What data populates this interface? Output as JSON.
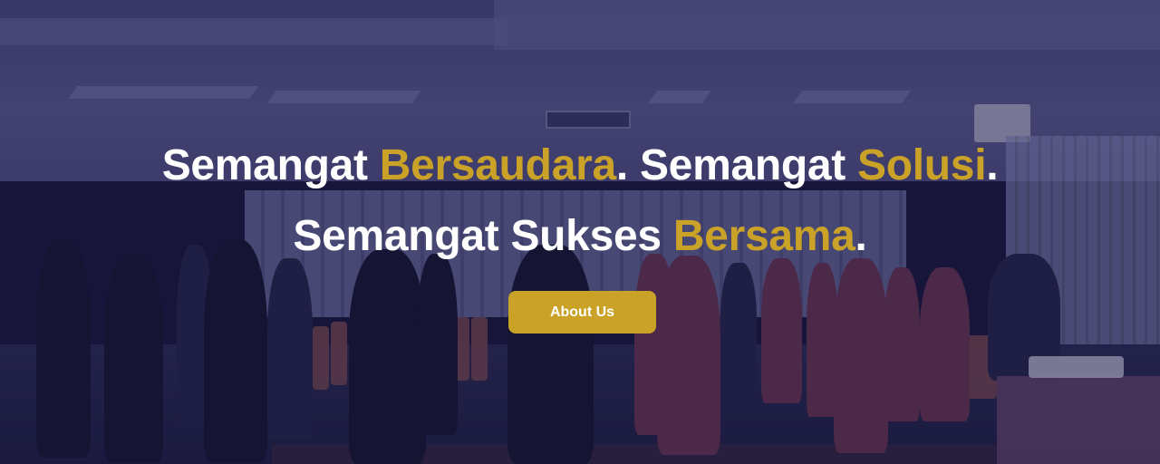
{
  "hero": {
    "line1": {
      "part1": "Semangat ",
      "accent1": "Bersaudara",
      "part2": ". Semangat ",
      "accent2": "Solusi",
      "part3": "."
    },
    "line2": {
      "part1": "Semangat Sukses ",
      "accent1": "Bersama",
      "part2": "."
    },
    "cta_label": "About Us"
  },
  "colors": {
    "accent": "#c9a227",
    "headline": "#ffffff",
    "overlay": "#14123c"
  },
  "background": {
    "description_icon": "event-hall-photo"
  }
}
